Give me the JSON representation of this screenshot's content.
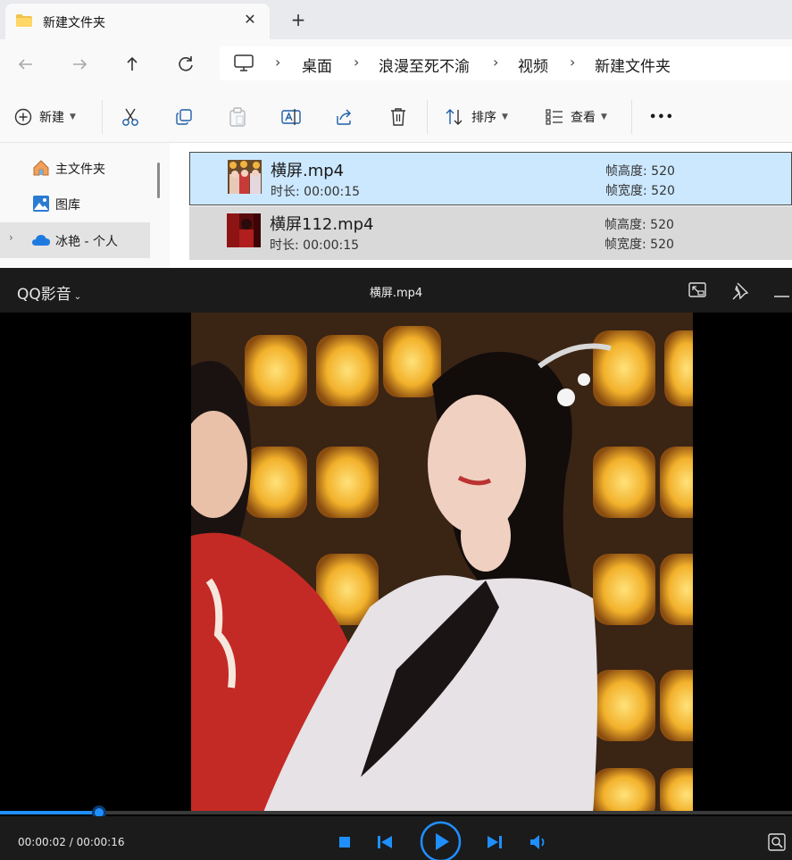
{
  "explorer": {
    "tab": {
      "title": "新建文件夹",
      "close_glyph": "✕",
      "new_tab_glyph": "+"
    },
    "nav": {
      "back_icon": "arrow-left-icon",
      "forward_icon": "arrow-right-icon",
      "up_icon": "arrow-up-icon",
      "refresh_icon": "refresh-icon",
      "breadcrumb": [
        "桌面",
        "浪漫至死不渝",
        "视频",
        "新建文件夹"
      ],
      "separator": "›"
    },
    "commands": {
      "new_label": "新建",
      "sort_label": "排序",
      "view_label": "查看",
      "more_label": "•••"
    },
    "sidebar": {
      "items": [
        {
          "label": "主文件夹",
          "icon": "home-icon"
        },
        {
          "label": "图库",
          "icon": "gallery-icon"
        },
        {
          "label": "冰艳 - 个人",
          "icon": "onedrive-cloud-icon",
          "expander": "›"
        }
      ]
    },
    "files": [
      {
        "name": "横屏.mp4",
        "duration": "时长: 00:00:15",
        "frame_height": "帧高度: 520",
        "frame_width": "帧宽度: 520",
        "selected": true
      },
      {
        "name": "横屏112.mp4",
        "duration": "时长: 00:00:15",
        "frame_height": "帧高度: 520",
        "frame_width": "帧宽度: 520",
        "selected": false
      }
    ]
  },
  "player": {
    "brand": "QQ影音",
    "brand_caret": "⌄",
    "title": "横屏.mp4",
    "time": "00:00:02 / 00:00:16",
    "progress_fraction": 0.125,
    "accent": "#1f8fff"
  }
}
